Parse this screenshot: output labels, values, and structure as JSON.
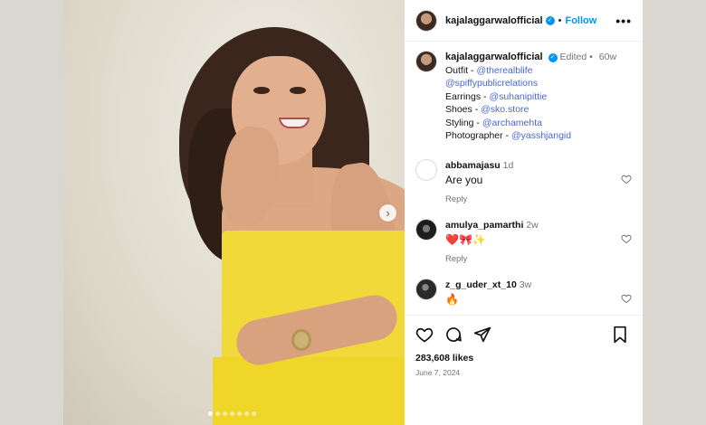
{
  "post": {
    "username": "kajalaggarwalofficial",
    "follow_label": "Follow",
    "dot": "•",
    "more_label": "•••"
  },
  "caption": {
    "username": "kajalaggarwalofficial",
    "edited": "Edited",
    "age": "60w",
    "lines": [
      {
        "label": "Outfit - ",
        "mention": "@therealblife"
      },
      {
        "label": "",
        "mention": "@spiffypublicrelations"
      },
      {
        "label": "Earrings - ",
        "mention": "@suhanipittie"
      },
      {
        "label": "Shoes - ",
        "mention": "@sko.store"
      },
      {
        "label": "Styling - ",
        "mention": "@archamehta"
      },
      {
        "label": "Photographer - ",
        "mention": "@yasshjangid"
      }
    ]
  },
  "comments": [
    {
      "username": "abbamajasu",
      "age": "1d",
      "text": "Are you",
      "reply": "Reply"
    },
    {
      "username": "amulya_pamarthi",
      "age": "2w",
      "text": "❤️🎀✨",
      "reply": "Reply"
    },
    {
      "username": "z_g_uder_xt_10",
      "age": "3w",
      "text": "🔥",
      "reply": ""
    }
  ],
  "likes": "283,608 likes",
  "date": "June 7, 2024",
  "carousel": {
    "next_label": "›",
    "dot_count": 7,
    "active_dot": 0
  }
}
